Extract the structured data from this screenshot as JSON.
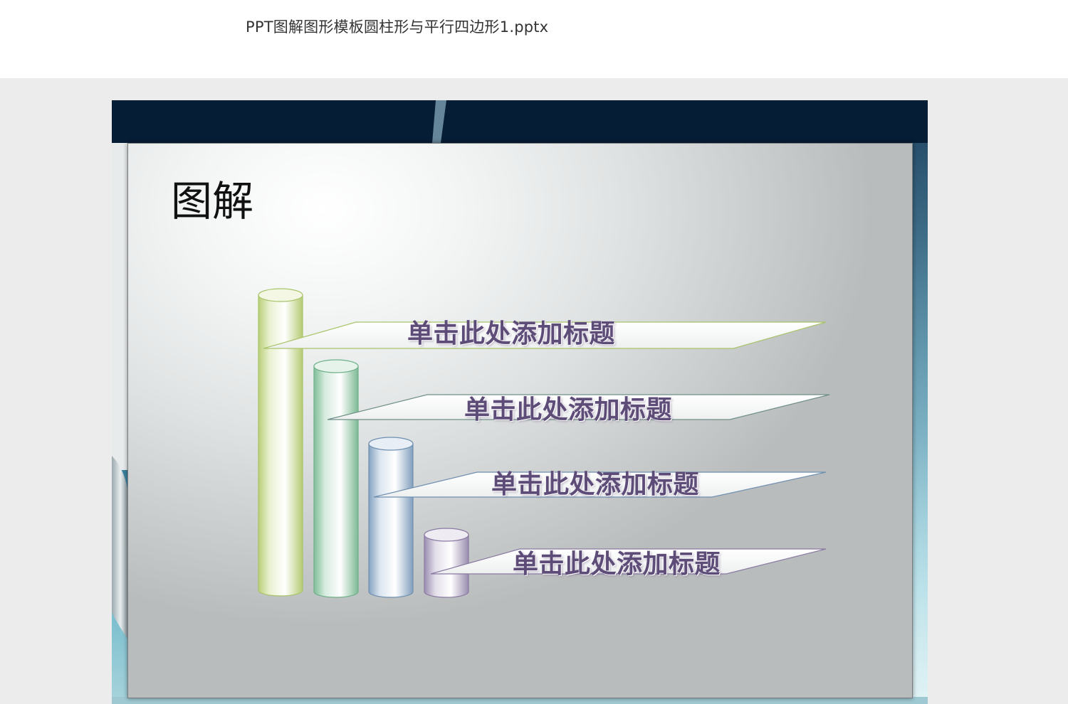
{
  "document": {
    "file_name": "PPT图解图形模板圆柱形与平行四边形1.pptx"
  },
  "slide": {
    "title": "图解",
    "items": [
      {
        "label": "单击此处添加标题",
        "color": "#a9c46a"
      },
      {
        "label": "单击此处添加标题",
        "color": "#6fb08a"
      },
      {
        "label": "单击此处添加标题",
        "color": "#6f8fb0"
      },
      {
        "label": "单击此处添加标题",
        "color": "#8a7aa2"
      }
    ]
  }
}
